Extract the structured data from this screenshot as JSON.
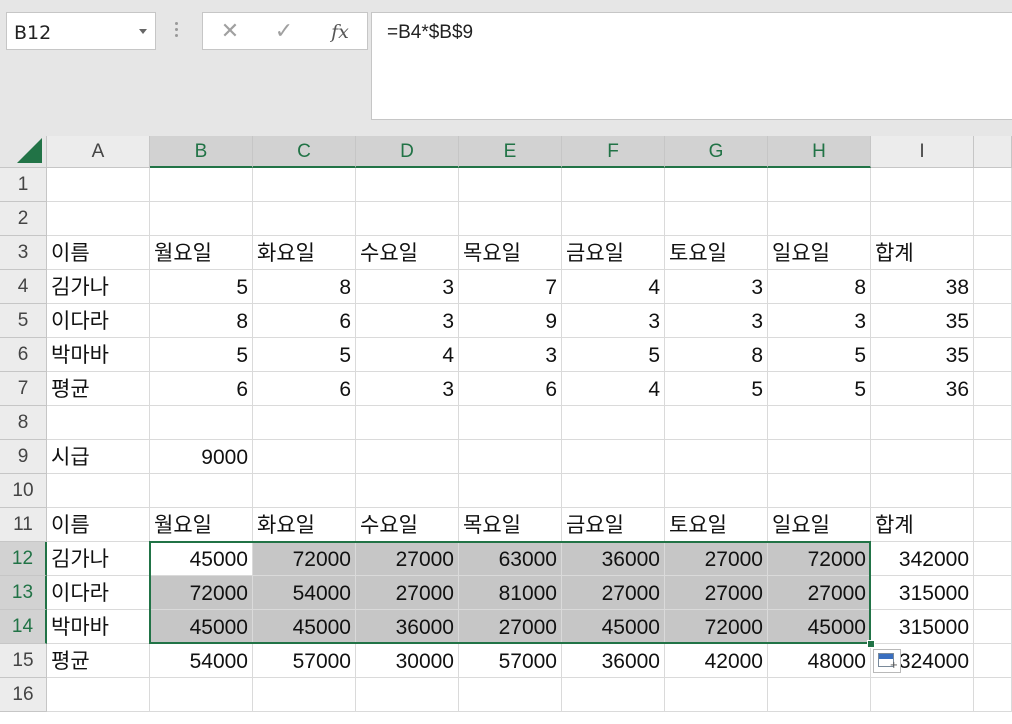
{
  "name_box": {
    "value": "B12"
  },
  "formula_bar": {
    "value": "=B4*$B$9",
    "cancel_glyph": "✕",
    "enter_glyph": "✓",
    "fx_label": "fx"
  },
  "columns": [
    "A",
    "B",
    "C",
    "D",
    "E",
    "F",
    "G",
    "H",
    "I"
  ],
  "rows": [
    {
      "num": "1",
      "cells": [
        "",
        "",
        "",
        "",
        "",
        "",
        "",
        "",
        ""
      ]
    },
    {
      "num": "2",
      "cells": [
        "",
        "",
        "",
        "",
        "",
        "",
        "",
        "",
        ""
      ]
    },
    {
      "num": "3",
      "cells": [
        "이름",
        "월요일",
        "화요일",
        "수요일",
        "목요일",
        "금요일",
        "토요일",
        "일요일",
        "합계"
      ]
    },
    {
      "num": "4",
      "cells": [
        "김가나",
        "5",
        "8",
        "3",
        "7",
        "4",
        "3",
        "8",
        "38"
      ]
    },
    {
      "num": "5",
      "cells": [
        "이다라",
        "8",
        "6",
        "3",
        "9",
        "3",
        "3",
        "3",
        "35"
      ]
    },
    {
      "num": "6",
      "cells": [
        "박마바",
        "5",
        "5",
        "4",
        "3",
        "5",
        "8",
        "5",
        "35"
      ]
    },
    {
      "num": "7",
      "cells": [
        "평균",
        "6",
        "6",
        "3",
        "6",
        "4",
        "5",
        "5",
        "36"
      ]
    },
    {
      "num": "8",
      "cells": [
        "",
        "",
        "",
        "",
        "",
        "",
        "",
        "",
        ""
      ]
    },
    {
      "num": "9",
      "cells": [
        "시급",
        "9000",
        "",
        "",
        "",
        "",
        "",
        "",
        ""
      ]
    },
    {
      "num": "10",
      "cells": [
        "",
        "",
        "",
        "",
        "",
        "",
        "",
        "",
        ""
      ]
    },
    {
      "num": "11",
      "cells": [
        "이름",
        "월요일",
        "화요일",
        "수요일",
        "목요일",
        "금요일",
        "토요일",
        "일요일",
        "합계"
      ]
    },
    {
      "num": "12",
      "cells": [
        "김가나",
        "45000",
        "72000",
        "27000",
        "63000",
        "36000",
        "27000",
        "72000",
        "342000"
      ]
    },
    {
      "num": "13",
      "cells": [
        "이다라",
        "72000",
        "54000",
        "27000",
        "81000",
        "27000",
        "27000",
        "27000",
        "315000"
      ]
    },
    {
      "num": "14",
      "cells": [
        "박마바",
        "45000",
        "45000",
        "36000",
        "27000",
        "45000",
        "72000",
        "45000",
        "315000"
      ]
    },
    {
      "num": "15",
      "cells": [
        "평균",
        "54000",
        "57000",
        "30000",
        "57000",
        "36000",
        "42000",
        "48000",
        "324000"
      ]
    },
    {
      "num": "16",
      "cells": [
        "",
        "",
        "",
        "",
        "",
        "",
        "",
        "",
        ""
      ]
    }
  ],
  "selection": {
    "range": "B12:H14",
    "active_cell": "B12",
    "accent_color": "#217346"
  },
  "quick_analysis": {
    "icon": "quick-analysis-icon"
  }
}
